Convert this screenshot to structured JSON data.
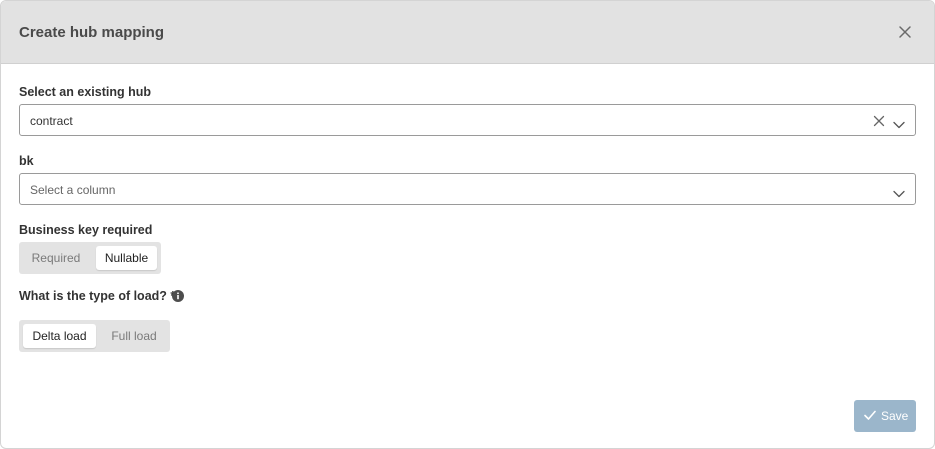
{
  "dialog": {
    "title": "Create hub mapping",
    "close_icon": "close-icon"
  },
  "hub": {
    "label": "Select an existing hub",
    "value": "contract",
    "clear_icon": "clear-icon",
    "chevron_icon": "chevron-down-icon"
  },
  "bk": {
    "label": "bk",
    "placeholder": "Select a column",
    "chevron_icon": "chevron-down-icon"
  },
  "business_key": {
    "label": "Business key required",
    "options": [
      "Required",
      "Nullable"
    ],
    "selected": "Nullable"
  },
  "load_type": {
    "label": "What is the type of load? *",
    "info_icon": "info-icon",
    "options": [
      "Delta load",
      "Full load"
    ],
    "selected": "Delta load"
  },
  "footer": {
    "save_label": "Save",
    "save_icon": "check-icon"
  },
  "colors": {
    "header_bg": "#e2e2e2",
    "save_button_bg": "#9bb6cb",
    "segment_bg": "#e3e3e3",
    "input_border": "#9a9a9a"
  }
}
